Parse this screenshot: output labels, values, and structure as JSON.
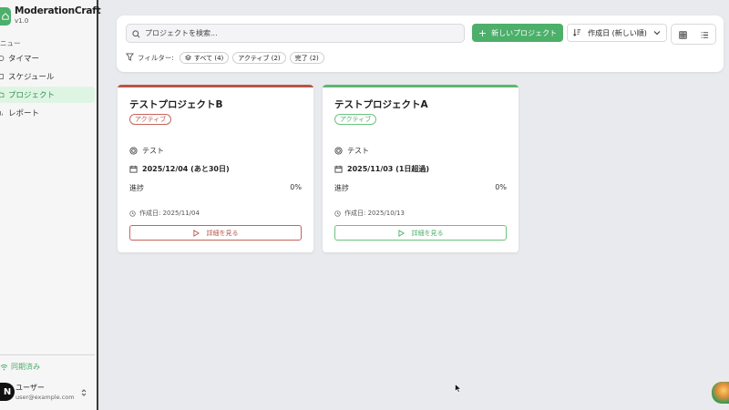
{
  "app": {
    "title": "ModerationCraft",
    "version": "v1.0"
  },
  "sidebar": {
    "menu_label": "ニュー",
    "items": [
      {
        "label": "タイマー",
        "icon": "clock-icon",
        "active": false
      },
      {
        "label": "スケジュール",
        "icon": "calendar-icon",
        "active": false
      },
      {
        "label": "プロジェクト",
        "icon": "folder-icon",
        "active": true
      },
      {
        "label": "レポート",
        "icon": "chart-icon",
        "active": false
      }
    ],
    "sync_status": "同期済み",
    "user": {
      "avatar_letter": "N",
      "name": "ユーザー",
      "email": "user@example.com"
    }
  },
  "toolbar": {
    "search_placeholder": "プロジェクトを検索...",
    "new_project_label": "新しいプロジェクト",
    "sort_label": "作成日 (新しい順)",
    "filter_label": "フィルター:",
    "filters": [
      {
        "label": "すべて (4)"
      },
      {
        "label": "アクティブ (2)"
      },
      {
        "label": "完了 (2)"
      }
    ]
  },
  "projects": [
    {
      "title": "テストプロジェクトB",
      "status": "アクティブ",
      "category": "テスト",
      "due": "2025/12/04 (あと30日)",
      "progress_label": "進捗",
      "progress": "0%",
      "created": "作成日: 2025/11/04",
      "detail_label": "詳細を見る",
      "accent": "#b8554a"
    },
    {
      "title": "テストプロジェクトA",
      "status": "アクティブ",
      "category": "テスト",
      "due": "2025/11/03 (1日超過)",
      "progress_label": "進捗",
      "progress": "0%",
      "created": "作成日: 2025/10/13",
      "detail_label": "詳細を見る",
      "accent": "#5cb870"
    }
  ],
  "colors": {
    "brand": "#4caf6a",
    "active_bg": "#dff5e4"
  }
}
